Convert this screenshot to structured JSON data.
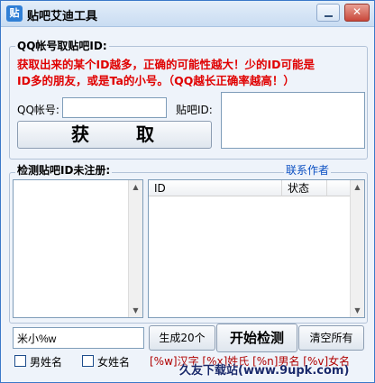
{
  "window": {
    "title": "贴吧艾迪工具",
    "icon_glyph": "贴"
  },
  "section1": {
    "label": "QQ帐号取贴吧ID:",
    "note_line1": "获取出来的某个ID越多，正确的可能性越大！少的ID可能是",
    "note_line2": "ID多的朋友，或是Ta的小号。（QQ越长正确率越高！）",
    "qq_label": "QQ帐号:",
    "qq_value": "",
    "tieba_label": "贴吧ID:",
    "fetch_button": "获　　取"
  },
  "section2": {
    "label": "检测贴吧ID未注册:",
    "contact_link": "联系作者",
    "columns": [
      "ID",
      "状态"
    ],
    "rows": []
  },
  "bottom": {
    "format_input": "米小%w",
    "generate_button": "生成20个",
    "start_button": "开始检测",
    "clear_button": "清空所有",
    "male_checkbox": "男姓名",
    "female_checkbox": "女姓名",
    "format_hint": "[%w]汉字 [%x]姓氏 [%n]男名 [%v]女名"
  },
  "watermark": "久友下载站(www.9upk.com)",
  "colors": {
    "note_red": "#e00000",
    "link_blue": "#0a4fc2",
    "border_blue": "#3a78c8"
  }
}
